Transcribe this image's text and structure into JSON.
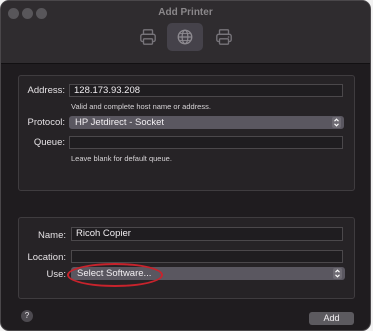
{
  "window": {
    "title": "Add Printer"
  },
  "toolbar": {
    "tabs": [
      {
        "icon": "default-printer-icon",
        "selected": false
      },
      {
        "icon": "ip-globe-icon",
        "selected": true
      },
      {
        "icon": "windows-printer-icon",
        "selected": false
      }
    ]
  },
  "connection": {
    "address_label": "Address:",
    "address_value": "128.173.93.208",
    "address_hint": "Valid and complete host name or address.",
    "protocol_label": "Protocol:",
    "protocol_value": "HP Jetdirect - Socket",
    "queue_label": "Queue:",
    "queue_value": "",
    "queue_hint": "Leave blank for default queue."
  },
  "details": {
    "name_label": "Name:",
    "name_value": "Ricoh Copier",
    "location_label": "Location:",
    "location_value": "",
    "use_label": "Use:",
    "use_value": "Select Software..."
  },
  "footer": {
    "help_label": "?",
    "add_label": "Add"
  },
  "colors": {
    "annotation": "#c8232c",
    "window_bg": "#1f1c1f",
    "selected_tab": "#45424a"
  }
}
